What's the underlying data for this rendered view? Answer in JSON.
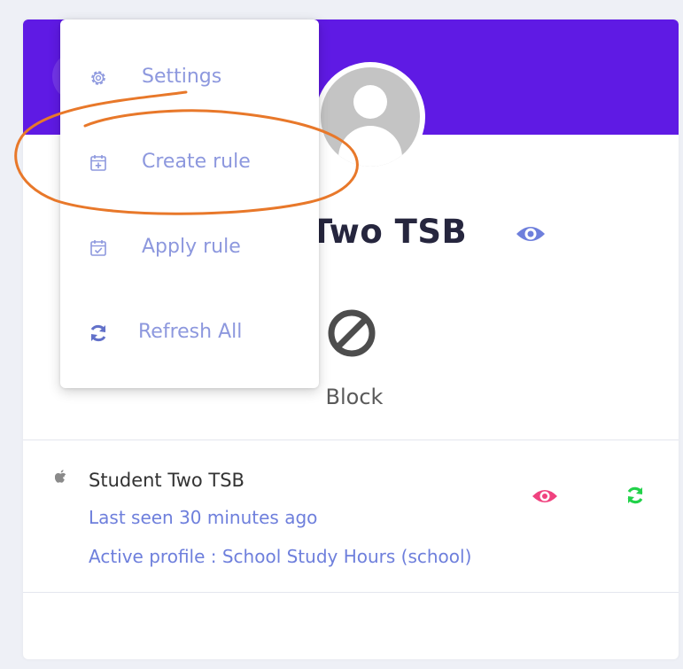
{
  "menu": {
    "items": [
      {
        "label": "Settings",
        "icon": "gear-icon"
      },
      {
        "label": "Create rule",
        "icon": "calendar-plus-icon"
      },
      {
        "label": "Apply rule",
        "icon": "calendar-check-icon"
      },
      {
        "label": "Refresh All",
        "icon": "refresh-icon"
      }
    ]
  },
  "profile": {
    "name_visible": "Two TSB",
    "block_label": "Block"
  },
  "device": {
    "name": "Student Two TSB",
    "last_seen": "Last seen 30 minutes ago",
    "active_profile": "Active profile : School Study Hours (school)",
    "platform_icon": "apple-icon"
  },
  "colors": {
    "header": "#5f1ae4",
    "menu_text": "#8d98de",
    "link_text": "#6e7fdc",
    "eye_pink": "#f0427f",
    "refresh_green": "#22d24a",
    "annotation_orange": "#e8782a"
  }
}
